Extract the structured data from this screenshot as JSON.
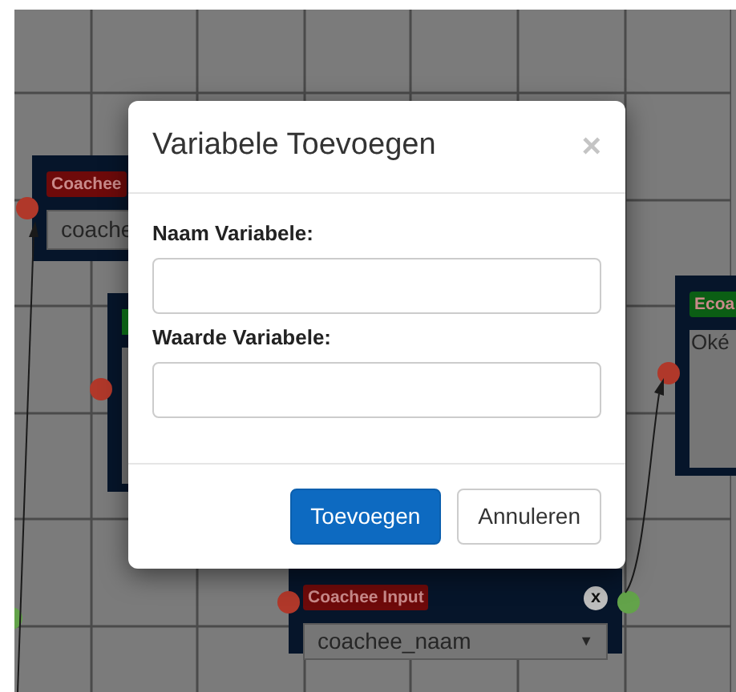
{
  "canvas": {
    "nodes": [
      {
        "kind": "field",
        "label": "Coachee",
        "color": "#6e0a0a",
        "value": "coache"
      },
      {
        "kind": "text",
        "color": "#0b5e14"
      },
      {
        "kind": "text",
        "label": "Ecoa",
        "color": "#0b5e14",
        "value": "Oké"
      },
      {
        "kind": "select",
        "label": "Coachee Input",
        "color": "#6e0a0a",
        "value": "coachee_naam",
        "close": "x",
        "caret": "▼"
      }
    ]
  },
  "modal": {
    "title": "Variabele Toevoegen",
    "close": "×",
    "fields": [
      {
        "label": "Naam Variabele:"
      },
      {
        "label": "Waarde Variabele:"
      }
    ],
    "buttons": [
      {
        "label": "Toevoegen",
        "kind": "primary"
      },
      {
        "label": "Annuleren",
        "kind": "default"
      }
    ]
  }
}
